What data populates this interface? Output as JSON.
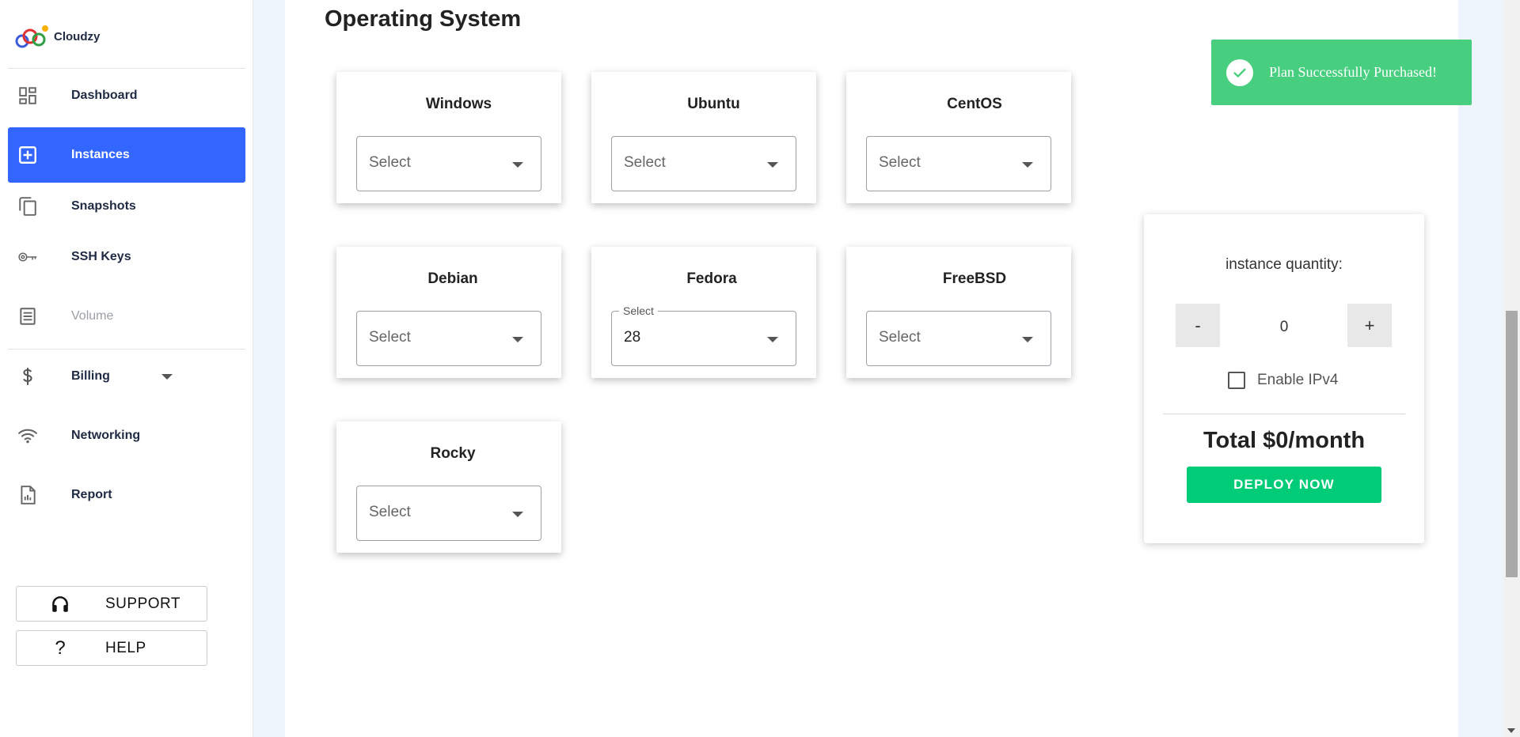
{
  "brand": {
    "name": "Cloudzy"
  },
  "sidebar": {
    "items": [
      {
        "label": "Dashboard",
        "icon": "dashboard-icon"
      },
      {
        "label": "Instances",
        "icon": "add-box-icon",
        "active": true
      },
      {
        "label": "Snapshots",
        "icon": "copy-icon"
      },
      {
        "label": "SSH Keys",
        "icon": "key-icon"
      },
      {
        "label": "Volume",
        "icon": "volume-icon",
        "disabled": true
      },
      {
        "label": "Billing",
        "icon": "dollar-icon",
        "has_dropdown": true
      },
      {
        "label": "Networking",
        "icon": "wifi-icon"
      },
      {
        "label": "Report",
        "icon": "report-icon"
      }
    ],
    "support_label": "SUPPORT",
    "help_label": "HELP",
    "help_icon_glyph": "?"
  },
  "main": {
    "section_title": "Operating System",
    "os_cards": [
      {
        "name": "Windows",
        "value": "Select"
      },
      {
        "name": "Ubuntu",
        "value": "Select"
      },
      {
        "name": "CentOS",
        "value": "Select"
      },
      {
        "name": "Debian",
        "value": "Select"
      },
      {
        "name": "Fedora",
        "value": "28",
        "legend": "Select"
      },
      {
        "name": "FreeBSD",
        "value": "Select"
      },
      {
        "name": "Rocky",
        "value": "Select"
      }
    ]
  },
  "order": {
    "quantity_label": "instance quantity:",
    "decrement_label": "-",
    "increment_label": "+",
    "quantity": "0",
    "ipv4_label": "Enable IPv4",
    "ipv4_checked": false,
    "total": "Total $0/month",
    "deploy_label": "DEPLOY NOW"
  },
  "toast": {
    "message": "Plan Successfully Purchased!"
  },
  "colors": {
    "accent": "#3366ff",
    "success": "#47cf7f",
    "deploy": "#00cc77"
  }
}
